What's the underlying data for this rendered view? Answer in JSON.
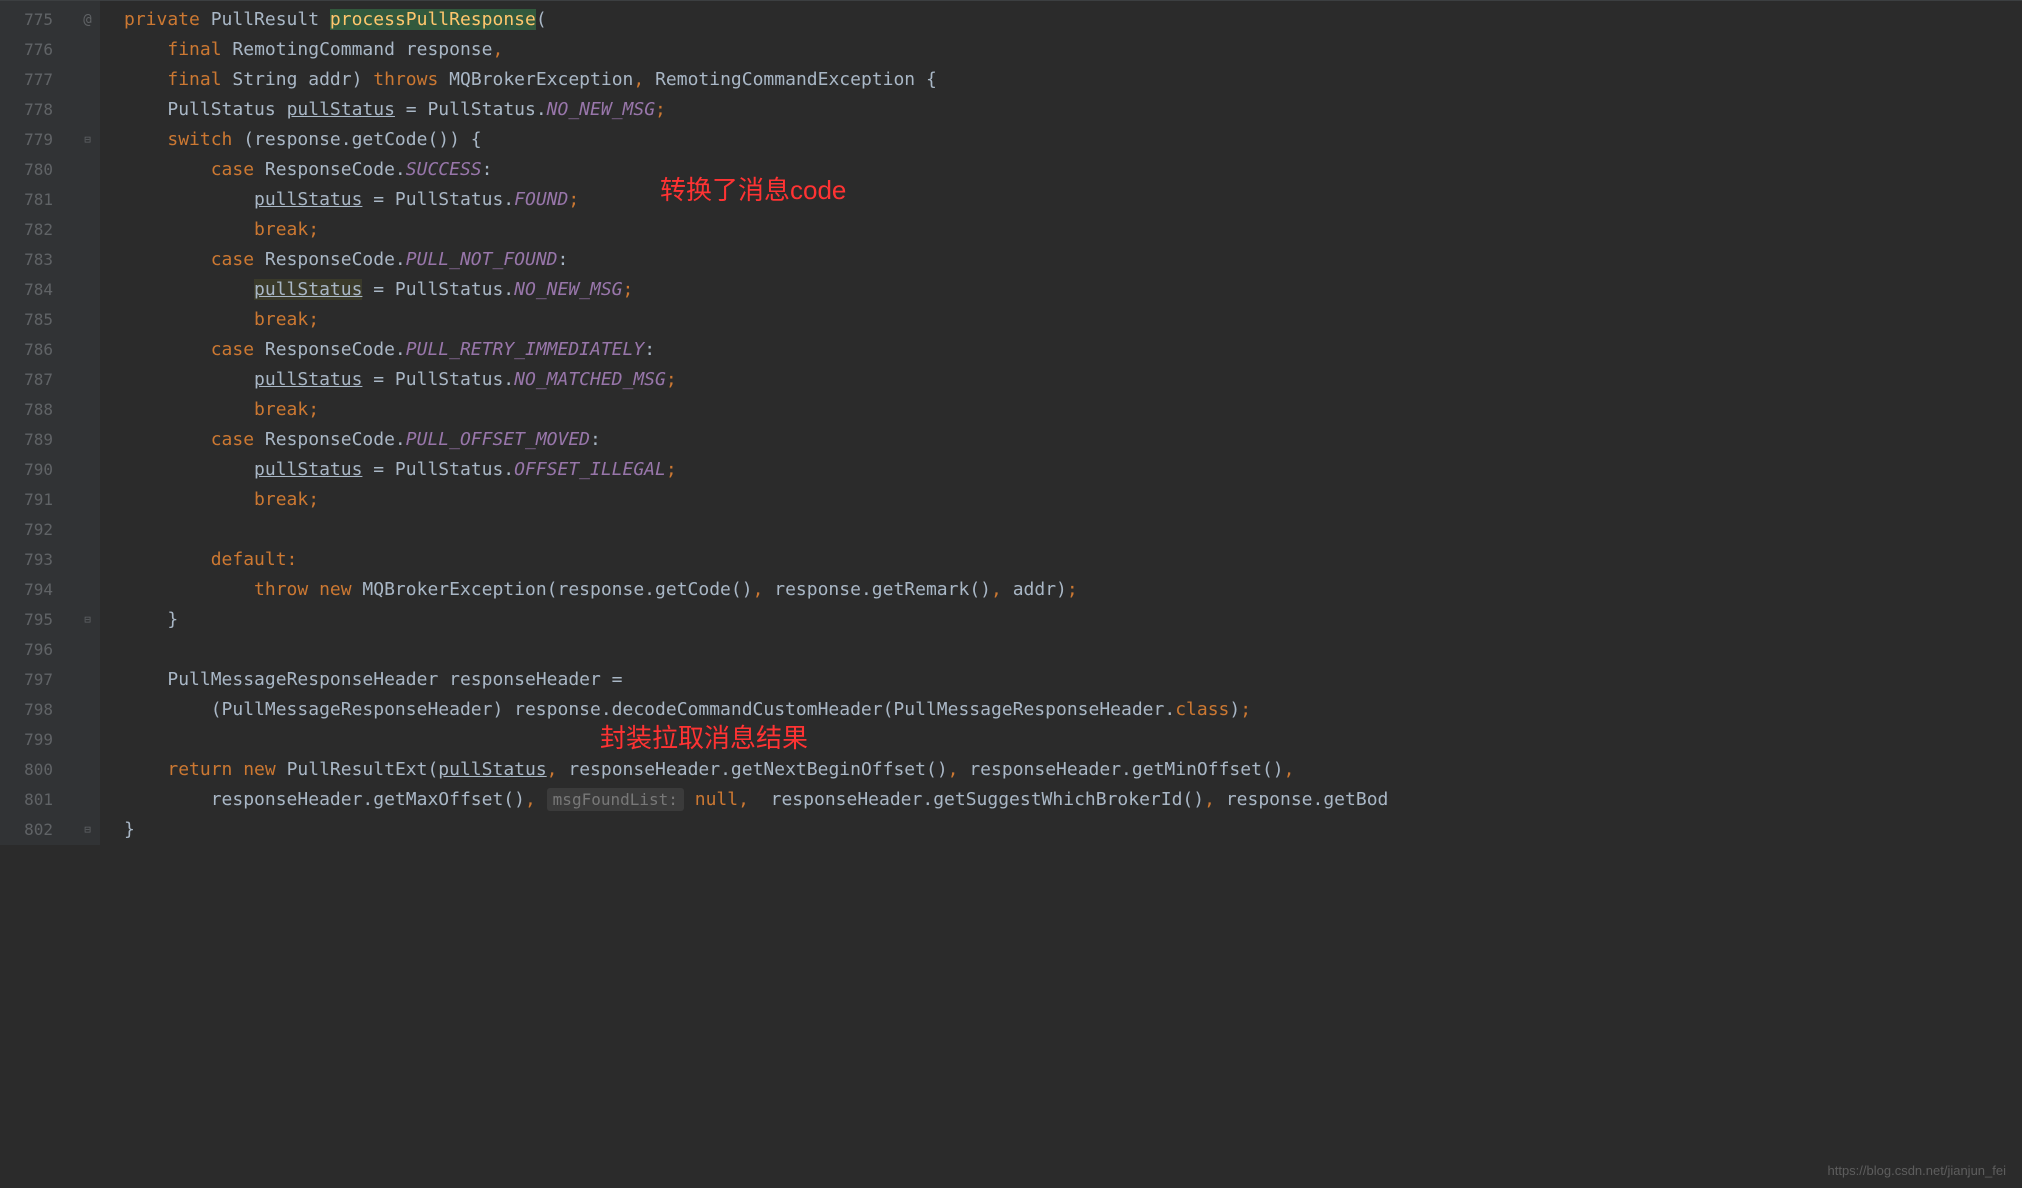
{
  "line_numbers": [
    "775",
    "776",
    "777",
    "778",
    "779",
    "780",
    "781",
    "782",
    "783",
    "784",
    "785",
    "786",
    "787",
    "788",
    "789",
    "790",
    "791",
    "792",
    "793",
    "794",
    "795",
    "796",
    "797",
    "798",
    "799",
    "800",
    "801",
    "802"
  ],
  "markers": [
    "@",
    "",
    "",
    "",
    "⊟",
    "",
    "",
    "",
    "",
    "",
    "",
    "",
    "",
    "",
    "",
    "",
    "",
    "",
    "",
    "",
    "⊟",
    "",
    "",
    "",
    "",
    "",
    "",
    "⊟"
  ],
  "annotations": {
    "a1": "转换了消息code",
    "a2": "封装拉取消息结果"
  },
  "code": {
    "t775_private": "private ",
    "t775_type": "PullResult ",
    "t775_method": "processPullResponse",
    "t775_end": "(",
    "t776_ind": "    ",
    "t776_final": "final ",
    "t776_type": "RemotingCommand response",
    "t776_comma": ",",
    "t777_ind": "    ",
    "t777_final": "final ",
    "t777_type": "String addr) ",
    "t777_throws": "throws ",
    "t777_exc": "MQBrokerException",
    "t777_c": ", ",
    "t777_exc2": "RemotingCommandException {",
    "t778_ind": "    ",
    "t778_a": "PullStatus ",
    "t778_var": "pullStatus",
    "t778_b": " = PullStatus.",
    "t778_enum": "NO_NEW_MSG",
    "t778_semi": ";",
    "t779_ind": "    ",
    "t779_sw": "switch ",
    "t779_expr": "(response.getCode()) {",
    "t780_ind": "        ",
    "t780_case": "case ",
    "t780_rc": "ResponseCode.",
    "t780_e": "SUCCESS",
    "t780_c": ":",
    "t781_ind": "            ",
    "t781_var": "pullStatus",
    "t781_a": " = PullStatus.",
    "t781_e": "FOUND",
    "t781_s": ";",
    "t782_ind": "            ",
    "t782_b": "break;",
    "t783_ind": "        ",
    "t783_case": "case ",
    "t783_rc": "ResponseCode.",
    "t783_e": "PULL_NOT_FOUND",
    "t783_c": ":",
    "t784_ind": "            ",
    "t784_var": "pullStatus",
    "t784_a": " = PullStatus.",
    "t784_e": "NO_NEW_MSG",
    "t784_s": ";",
    "t785_ind": "            ",
    "t785_b": "break;",
    "t786_ind": "        ",
    "t786_case": "case ",
    "t786_rc": "ResponseCode.",
    "t786_e": "PULL_RETRY_IMMEDIATELY",
    "t786_c": ":",
    "t787_ind": "            ",
    "t787_var": "pullStatus",
    "t787_a": " = PullStatus.",
    "t787_e": "NO_MATCHED_MSG",
    "t787_s": ";",
    "t788_ind": "            ",
    "t788_b": "break;",
    "t789_ind": "        ",
    "t789_case": "case ",
    "t789_rc": "ResponseCode.",
    "t789_e": "PULL_OFFSET_MOVED",
    "t789_c": ":",
    "t790_ind": "            ",
    "t790_var": "pullStatus",
    "t790_a": " = PullStatus.",
    "t790_e": "OFFSET_ILLEGAL",
    "t790_s": ";",
    "t791_ind": "            ",
    "t791_b": "break;",
    "t792": "",
    "t793_ind": "        ",
    "t793_d": "default:",
    "t794_ind": "            ",
    "t794_tn": "throw new ",
    "t794_ex": "MQBrokerException(response.getCode()",
    "t794_c1": ", ",
    "t794_r": "response.getRemark()",
    "t794_c2": ", ",
    "t794_a": "addr)",
    "t794_s": ";",
    "t795_ind": "    ",
    "t795_cb": "}",
    "t796": "",
    "t797_ind": "    ",
    "t797_a": "PullMessageResponseHeader responseHeader =",
    "t798_ind": "        ",
    "t798_a": "(PullMessageResponseHeader) response.decodeCommandCustomHeader(PullMessageResponseHeader.",
    "t798_cls": "class",
    "t798_b": ")",
    "t798_s": ";",
    "t799": "",
    "t800_ind": "    ",
    "t800_ret": "return new ",
    "t800_a": "PullResultExt(",
    "t800_var": "pullStatus",
    "t800_c1": ", ",
    "t800_b": "responseHeader.getNextBeginOffset()",
    "t800_c2": ", ",
    "t800_c": "responseHeader.getMinOffset()",
    "t800_c3": ",",
    "t801_ind": "        ",
    "t801_a": "responseHeader.getMaxOffset()",
    "t801_c1": ", ",
    "t801_hint": "msgFoundList:",
    "t801_sp": " ",
    "t801_null": "null",
    "t801_c2": ", ",
    "t801_b": " responseHeader.getSuggestWhichBrokerId()",
    "t801_c3": ", ",
    "t801_e": "response.getBod",
    "t802_cb": "}"
  },
  "watermark": "https://blog.csdn.net/jianjun_fei"
}
